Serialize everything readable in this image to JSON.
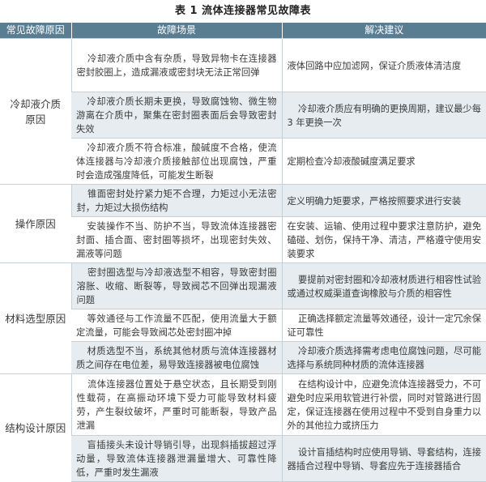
{
  "caption": "表 1   流体连接器常见故障表",
  "headers": [
    "常见故障原因",
    "故障场景",
    "解决建议"
  ],
  "groups": [
    {
      "category": [
        "冷却液介质",
        "原因"
      ],
      "rows": [
        {
          "scene": "冷却液介质中含有杂质，导致异物卡在连接器密封胶圈上，造成漏液或密封块无法正常回弹",
          "advice": "液体回路中应加滤网，保证介质液体清洁度"
        },
        {
          "scene": "冷却液介质长期未更换，导致腐蚀物、微生物游离在介质中，聚集在密封圈表面后会导致密封失效",
          "advice": "冷却液介质应有明确的更换周期，建议最少每 3 年更换一次"
        },
        {
          "scene": "冷却液介质不符合标准，酸碱度不合格，使流体连接器与冷却液介质接触部位出现腐蚀，严重时会造成强度降低，可能发生断裂",
          "advice": "定期检查冷却液酸碱度满足要求"
        }
      ]
    },
    {
      "category": [
        "操作原因"
      ],
      "rows": [
        {
          "scene": "锥面密封处拧紧力矩不合理，力矩过小无法密封，力矩过大损伤结构",
          "advice": "定义明确力矩要求，严格按照要求进行安装"
        },
        {
          "scene": "安装操作不当、防护不当，导致流体连接器密封面、插合面、密封圈等损坏，出现密封失效、漏液等问题",
          "advice": "在安装、运输、使用过程中要求注意防护，避免磕碰、划伤，保持干净、清洁，严格遵守使用安装要求"
        }
      ]
    },
    {
      "category": [
        "材料选型原因"
      ],
      "rows": [
        {
          "scene": "密封圈选型与冷却液选型不相容，导致密封圈溶胀、收缩、断裂等，导致阀芯不回弹出现漏液问题",
          "advice": "要提前对密封圈和冷却液材质进行相容性试验或通过权威渠道查询橡胶与介质的相容性"
        },
        {
          "scene": "等效通径与工作流量不匹配，使用流量大于额定流量，可能会导致阀芯处密封圈冲掉",
          "advice": "正确选择额定流量等效通径，设计一定冗余保证可靠性"
        },
        {
          "scene": "材质选型不当，系统其他材质与流体连接器材质之间存在电位差，易导致连接器被电位腐蚀",
          "advice": "冷却液介质选择需考虑电位腐蚀问题，尽可能选择与系统同种材质的流体连接器"
        }
      ]
    },
    {
      "category": [
        "结构设计原因"
      ],
      "rows": [
        {
          "scene": "流体连接器位置处于悬空状态，且长期受到刚性载荷，在高振动环境下受力可能导致材料疲劳，产生裂纹破坏，严重时可能断裂，导致产品泄漏",
          "advice": "在结构设计中，应避免流体连接器受力，不可避免时应采用软管进行补偿，同时对管路进行固定，保证连接器在使用过程中不受到自身重力以外的其他拉力或挤压力"
        },
        {
          "scene": "盲插接头未设计导销引导，出现斜插拔超过浮动量，导致流体连接器泄漏量增大、可靠性降低，严重时发生漏液",
          "advice": "设计盲插结构时应使用导销、导套结构，连接器插合过程中导销、导套应先于连接器插合"
        }
      ]
    }
  ]
}
